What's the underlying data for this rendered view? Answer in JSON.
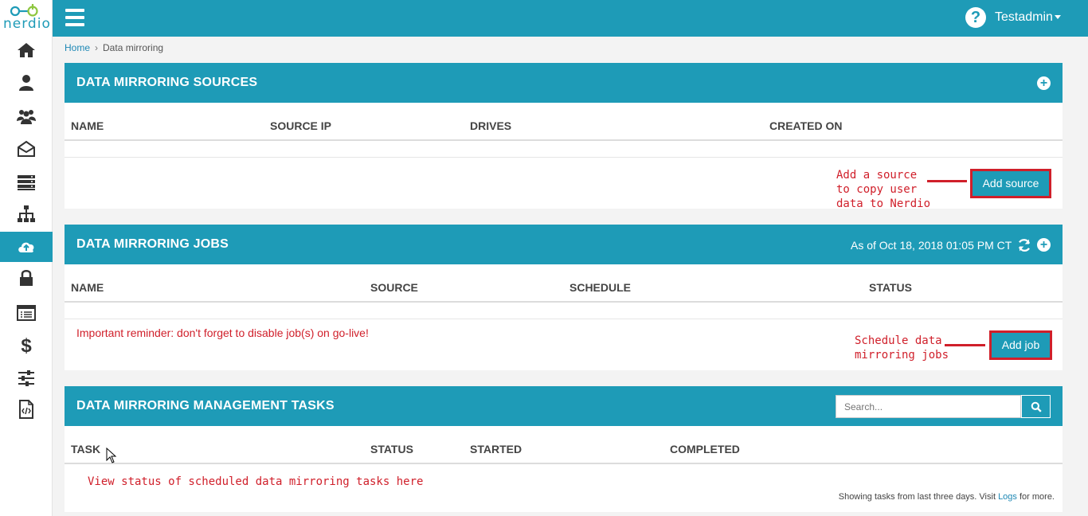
{
  "brand": {
    "logo_text": "nerdio"
  },
  "sidebar": {
    "items": [
      {
        "name": "home-icon"
      },
      {
        "name": "user-icon"
      },
      {
        "name": "users-group-icon"
      },
      {
        "name": "mail-open-icon"
      },
      {
        "name": "server-icon"
      },
      {
        "name": "sitemap-icon"
      },
      {
        "name": "cloud-upload-icon",
        "active": true
      },
      {
        "name": "lock-icon"
      },
      {
        "name": "list-icon"
      },
      {
        "name": "dollar-icon"
      },
      {
        "name": "sliders-icon"
      },
      {
        "name": "code-file-icon"
      }
    ]
  },
  "topbar": {
    "help_icon": "?",
    "user": "Testadmin"
  },
  "breadcrumb": {
    "home": "Home",
    "current": "Data mirroring"
  },
  "sources": {
    "title": "DATA MIRRORING SOURCES",
    "columns": [
      "NAME",
      "SOURCE IP",
      "DRIVES",
      "CREATED ON"
    ],
    "add_button": "Add source",
    "annotation": [
      "Add a source",
      "to copy user",
      "data to Nerdio"
    ]
  },
  "jobs": {
    "title": "DATA MIRRORING JOBS",
    "timestamp": "As of Oct 18, 2018 01:05 PM CT",
    "columns": [
      "NAME",
      "SOURCE",
      "SCHEDULE",
      "STATUS"
    ],
    "reminder": "Important reminder: don't forget to disable job(s) on go-live!",
    "add_button": "Add job",
    "annotation": [
      "Schedule data",
      "mirroring jobs"
    ]
  },
  "tasks": {
    "title": "DATA MIRRORING MANAGEMENT TASKS",
    "search_placeholder": "Search...",
    "columns": [
      "TASK",
      "STATUS",
      "STARTED",
      "COMPLETED"
    ],
    "annotation": "View status of scheduled data mirroring tasks here",
    "footer_prefix": "Showing tasks from last three days. Visit ",
    "footer_link": "Logs",
    "footer_suffix": " for more."
  },
  "colors": {
    "primary": "#1e9bb7",
    "annotation": "#d01f2a"
  }
}
